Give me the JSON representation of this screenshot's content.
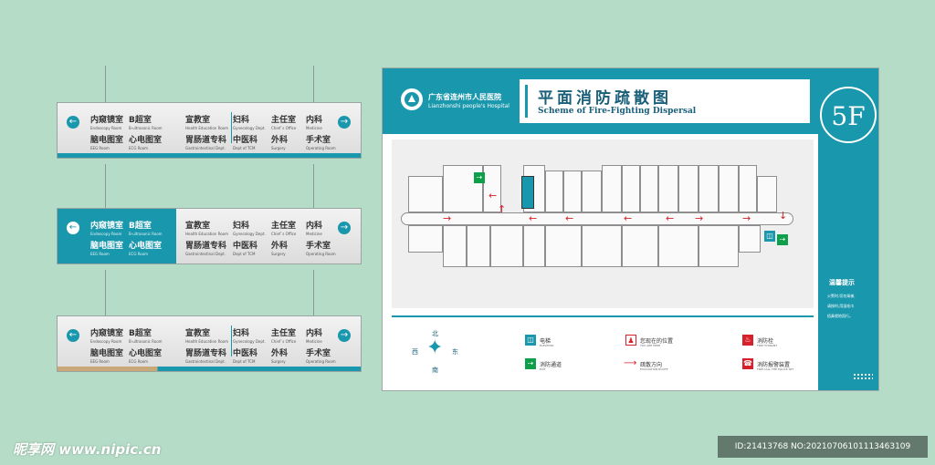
{
  "colors": {
    "teal": "#1997ac",
    "background": "#b5dcc6",
    "red": "#d8202a",
    "green": "#0e9f4b",
    "gold": "#c8a877"
  },
  "sign": {
    "items": [
      {
        "cn": "内窥镜室",
        "en": "Endoscopy Room"
      },
      {
        "cn": "B超室",
        "en": "B-ultrasonic Room"
      },
      {
        "cn": "宣教室",
        "en": "Health Education Room"
      },
      {
        "cn": "妇科",
        "en": "Gynecology Dept."
      },
      {
        "cn": "主任室",
        "en": "Chief`s Office"
      },
      {
        "cn": "内科",
        "en": "Medicine"
      },
      {
        "cn": "脑电图室",
        "en": "EEG Room"
      },
      {
        "cn": "心电图室",
        "en": "ECG Room"
      },
      {
        "cn": "胃肠道专科",
        "en": "Gastrointestinal Dept."
      },
      {
        "cn": "中医科",
        "en": "Dept of TCM"
      },
      {
        "cn": "外科",
        "en": "Surgery"
      },
      {
        "cn": "手术室",
        "en": "Operating Room"
      }
    ],
    "arrow_left": "←",
    "arrow_right": "→"
  },
  "board": {
    "hospital_cn": "广东省连州市人民医院",
    "hospital_en": "Lianzhonshi people's Hospital",
    "title_cn": "平面消防疏散图",
    "title_en": "Scheme of Fire-Fighting Dispersal",
    "floor": "5F",
    "tips_title": "温馨提示",
    "tips_lines": [
      "火警时,切勿乘梯,",
      "请按时,用湿毛巾",
      "捂鼻就地而行。"
    ],
    "compass": {
      "north": "北",
      "south": "南",
      "east": "东",
      "west": "西"
    },
    "legend": [
      {
        "icon": "elevator-icon",
        "cn": "电梯",
        "en": "ELEVATOR"
      },
      {
        "icon": "exit-icon",
        "cn": "消防通道",
        "en": "EXIT"
      },
      {
        "icon": "you-are-here-icon",
        "cn": "您现在的位置",
        "en": "YOU ARE HERE"
      },
      {
        "icon": "route-arrow-icon",
        "cn": "疏散方向",
        "en": "EVACUATION ROUTE"
      },
      {
        "icon": "fire-hydrant-icon",
        "cn": "消防栓",
        "en": "FIRE HYDRANT"
      },
      {
        "icon": "fire-alarm-icon",
        "cn": "消防报警装置",
        "en": "FIRE CALL THE POLICE SET"
      }
    ],
    "arrow": "→",
    "arrow_left": "←"
  },
  "watermark": {
    "logo": "昵享网 www.nipic.cn",
    "id": "ID:21413768 NO:20210706101113463109"
  }
}
